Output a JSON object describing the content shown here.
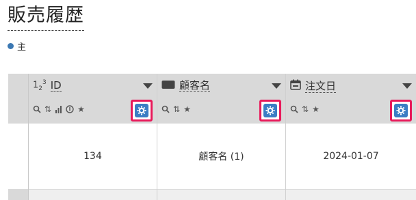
{
  "page": {
    "title": "販売履歴"
  },
  "legend": {
    "label": "主",
    "color": "#3b78b3"
  },
  "colors": {
    "highlight": "#e8195a",
    "gear_bg": "#3b7dc4",
    "header_bg": "#d9d9d9"
  },
  "columns": [
    {
      "label": "ID",
      "type_icon": "number-type-icon",
      "tools": [
        "search-icon",
        "sort-icon",
        "bar-chart-icon",
        "info-circle-icon",
        "star-icon"
      ]
    },
    {
      "label": "顧客名",
      "type_icon": "text-type-icon",
      "tools": [
        "search-icon",
        "sort-icon",
        "star-icon"
      ]
    },
    {
      "label": "注文日",
      "type_icon": "calendar-icon",
      "tools": [
        "search-icon",
        "sort-icon",
        "star-icon"
      ]
    }
  ],
  "rows": [
    {
      "cells": [
        "134",
        "顧客名 (1)",
        "2024-01-07"
      ]
    }
  ]
}
